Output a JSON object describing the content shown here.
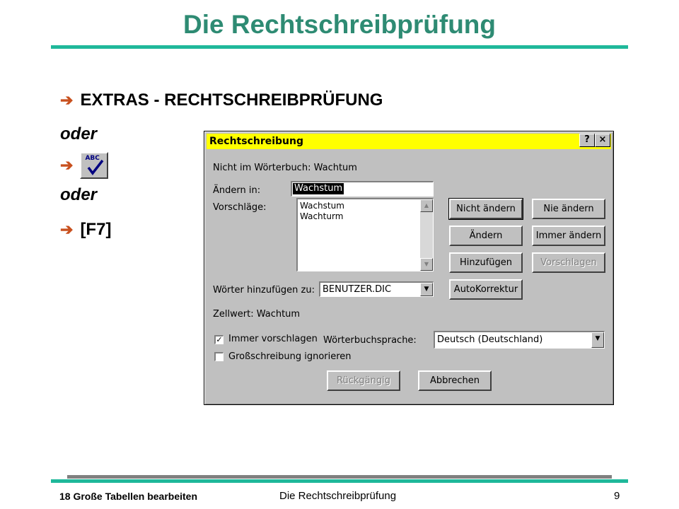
{
  "slide": {
    "title": "Die Rechtschreibprüfung",
    "menu_path": "EXTRAS - RECHTSCHREIBPRÜFUNG",
    "oder1": "oder",
    "oder2": "oder",
    "shortcut": "[F7]",
    "arrow": "è",
    "toolbar_icon_label": "ABC"
  },
  "dialog": {
    "title": "Rechtschreibung",
    "help": "?",
    "close": "×",
    "not_in_dict": "Nicht im Wörterbuch: Wachtum",
    "change_to_label": "Ändern in:",
    "change_to_value": "Wachstum",
    "suggestions_label": "Vorschläge:",
    "suggestions": [
      "Wachstum",
      "Wachturm"
    ],
    "add_words_label": "Wörter hinzufügen zu:",
    "add_words_value": "BENUTZER.DIC",
    "cell_value": "Zellwert: Wachtum",
    "always_suggest": "Immer vorschlagen",
    "dict_language_label": "Wörterbuchsprache:",
    "dict_language_value": "Deutsch (Deutschland)",
    "ignore_caps": "Großschreibung ignorieren",
    "buttons": {
      "ignore": "Nicht ändern",
      "ignore_all": "Nie ändern",
      "change": "Ändern",
      "change_all": "Immer ändern",
      "add": "Hinzufügen",
      "suggest": "Vorschlagen",
      "autocorrect": "AutoKorrektur",
      "undo": "Rückgängig",
      "cancel": "Abbrechen"
    }
  },
  "footer": {
    "left": "18 Große Tabellen bearbeiten",
    "center": "Die Rechtschreibprüfung",
    "page": "9"
  }
}
